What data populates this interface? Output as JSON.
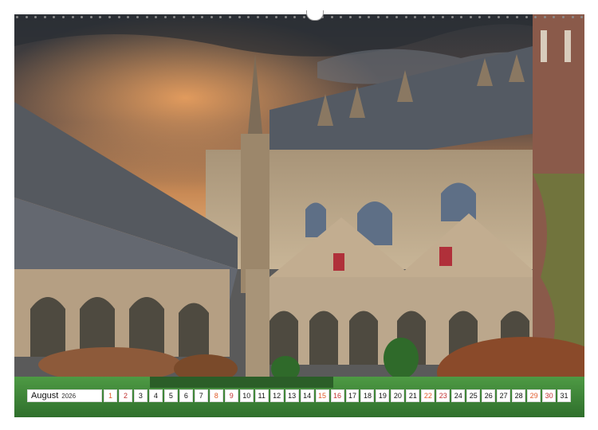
{
  "calendar": {
    "month": "August",
    "year": "2026",
    "days": [
      "1",
      "2",
      "3",
      "4",
      "5",
      "6",
      "7",
      "8",
      "9",
      "10",
      "11",
      "12",
      "13",
      "14",
      "15",
      "16",
      "17",
      "18",
      "19",
      "20",
      "21",
      "22",
      "23",
      "24",
      "25",
      "26",
      "27",
      "28",
      "29",
      "30",
      "31"
    ],
    "weekend_days": [
      "1",
      "8",
      "15",
      "22",
      "29"
    ],
    "sunday_days": [
      "2",
      "9",
      "16",
      "23",
      "30"
    ]
  },
  "photo": {
    "subject": "gothic-cathedral-cloister",
    "colors": {
      "sky_top": "#3a3f45",
      "sky_glow": "#e09a5a",
      "stone": "#b9a58c",
      "roof": "#4a4f58",
      "lawn": "#3f8a3a",
      "shrub": "#8a4a2a"
    }
  }
}
